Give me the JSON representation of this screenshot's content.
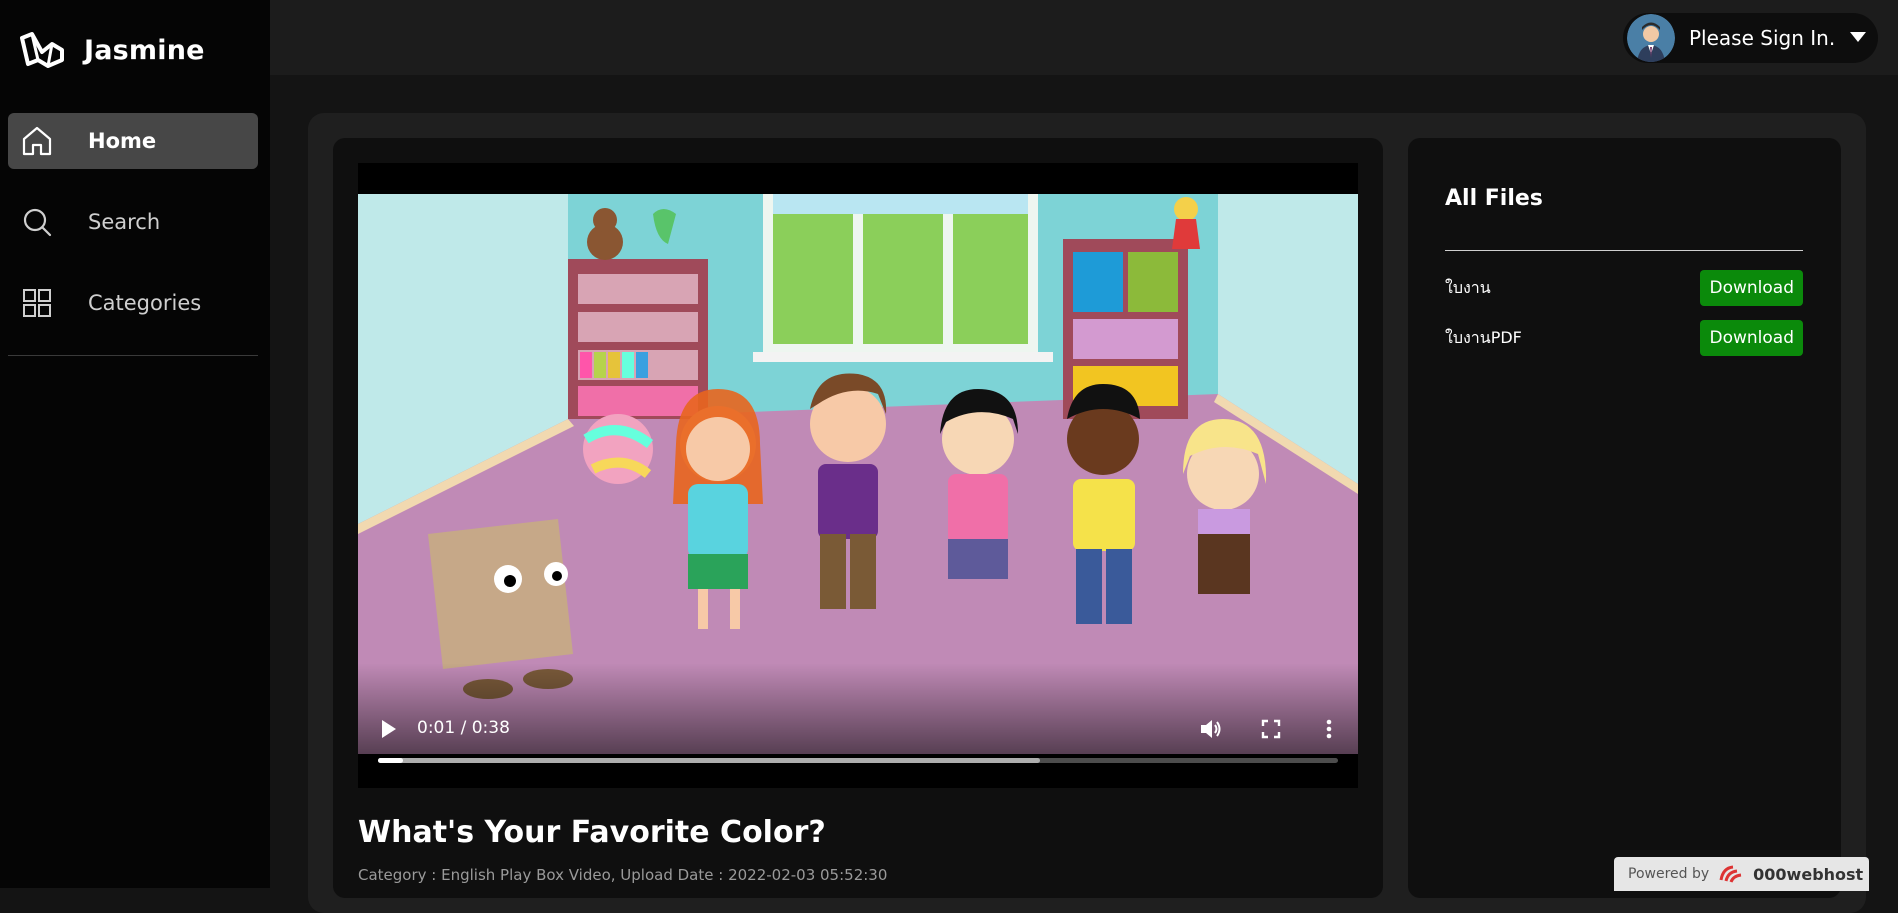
{
  "brand": {
    "name": "Jasmine",
    "logo_icon": "laravel-logo-icon"
  },
  "sidebar": {
    "items": [
      {
        "label": "Home",
        "icon": "home-icon",
        "active": true
      },
      {
        "label": "Search",
        "icon": "search-icon",
        "active": false
      },
      {
        "label": "Categories",
        "icon": "grid-icon",
        "active": false
      }
    ]
  },
  "header": {
    "user_label": "Please Sign In.",
    "avatar_icon": "user-avatar",
    "caret_icon": "caret-down-icon"
  },
  "video": {
    "time_display": "0:01 / 0:38",
    "played_fraction": 0.026,
    "buffered_fraction": 0.69,
    "title": "What's Your Favorite Color?",
    "meta": "Category : English Play Box Video, Upload Date : 2022-02-03 05:52:30"
  },
  "files": {
    "title": "All Files",
    "items": [
      {
        "name": "ใบงาน",
        "button_label": "Download"
      },
      {
        "name": "ใบงานPDF",
        "button_label": "Download"
      }
    ]
  },
  "footer": {
    "powered_label": "Powered by",
    "powered_brand": "000webhost"
  },
  "colors": {
    "accent_green": "#0b8a0b",
    "sidebar_bg": "#050505",
    "active_nav_bg": "#474747"
  }
}
